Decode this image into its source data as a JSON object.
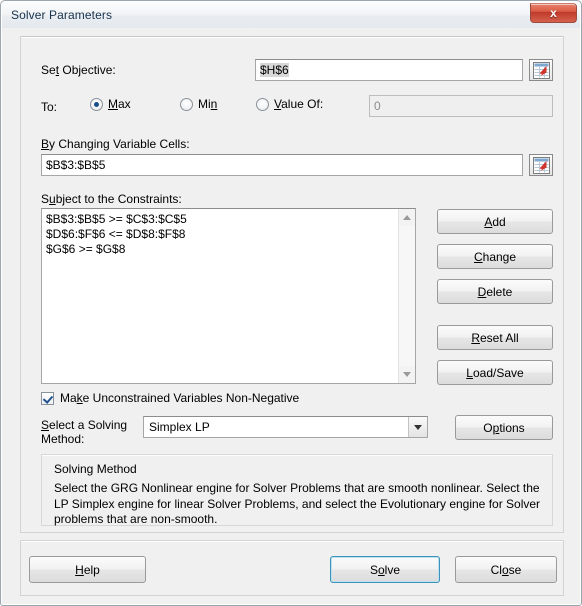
{
  "window": {
    "title": "Solver Parameters",
    "close_label": "x",
    "accent_default_button": "#3c93b8",
    "close_button_color": "#c0392b",
    "body_background": "#f0f0f0"
  },
  "objective": {
    "label_pre": "Se",
    "label_accel": "t",
    "label_post": " Objective:",
    "value": "$H$6",
    "picker_icon": "range-picker-icon"
  },
  "to_row": {
    "label": "To:",
    "options": [
      {
        "label_pre": "",
        "accel": "M",
        "label_post": "ax",
        "selected": true
      },
      {
        "label_pre": "Mi",
        "accel": "n",
        "label_post": "",
        "selected": false
      },
      {
        "label_pre": "",
        "accel": "V",
        "label_post": "alue Of:",
        "selected": false
      }
    ],
    "value_of_input": "0",
    "value_of_placeholder": "0"
  },
  "changing_cells": {
    "label_pre": "",
    "label_accel": "B",
    "label_post": "y Changing Variable Cells:",
    "value": "$B$3:$B$5",
    "picker_icon": "range-picker-icon"
  },
  "constraints": {
    "label_pre": "S",
    "label_accel": "u",
    "label_post": "bject to the Constraints:",
    "items": [
      "$B$3:$B$5 >= $C$3:$C$5",
      "$D$6:$F$6 <= $D$8:$F$8",
      "$G$6 >= $G$8"
    ],
    "buttons": [
      {
        "pre": "",
        "accel": "A",
        "post": "dd",
        "name": "add-constraint-button"
      },
      {
        "pre": "",
        "accel": "C",
        "post": "hange",
        "name": "change-constraint-button"
      },
      {
        "pre": "",
        "accel": "D",
        "post": "elete",
        "name": "delete-constraint-button"
      },
      {
        "pre": "",
        "accel": "R",
        "post": "eset All",
        "name": "reset-all-button"
      },
      {
        "pre": "",
        "accel": "L",
        "post": "oad/Save",
        "name": "load-save-button"
      }
    ]
  },
  "non_negative": {
    "pre": "Ma",
    "accel": "k",
    "post": "e Unconstrained Variables Non-Negative",
    "checked": true
  },
  "solving_method": {
    "label_pre": "",
    "label_accel": "S",
    "label_post": "elect a Solving",
    "label_line2": "Method:",
    "selected": "Simplex LP",
    "options": [
      "GRG Nonlinear",
      "Simplex LP",
      "Evolutionary"
    ],
    "options_button": {
      "pre": "O",
      "accel": "p",
      "post": "tions"
    }
  },
  "method_group": {
    "title": "Solving Method",
    "description": "Select the GRG Nonlinear engine for Solver Problems that are smooth nonlinear. Select the LP Simplex engine for linear Solver Problems, and select the Evolutionary engine for Solver problems that are non-smooth."
  },
  "footer": {
    "help": {
      "pre": "",
      "accel": "H",
      "post": "elp"
    },
    "solve": {
      "pre": "S",
      "accel": "o",
      "post": "lve"
    },
    "close": {
      "pre": "Cl",
      "accel": "o",
      "post": "se"
    }
  }
}
